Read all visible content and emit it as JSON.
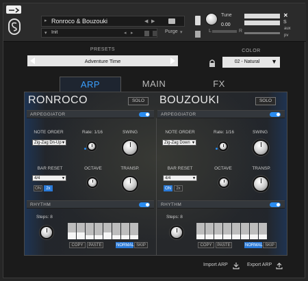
{
  "header": {
    "instrument_name": "Ronroco & Bouzouki",
    "multi_name": "Init",
    "purge_label": "Purge",
    "tune_label": "Tune",
    "tune_value": "0.00",
    "s_label": "S",
    "m_label": "M",
    "aux_label": "aux",
    "pv_label": "pv",
    "left_label": "L",
    "right_label": "R"
  },
  "presets": {
    "label": "PRESETS",
    "value": "Adventure Time"
  },
  "color": {
    "label": "COLOR",
    "value": "02 - Natural"
  },
  "tabs": [
    {
      "label": "ARP"
    },
    {
      "label": "MAIN"
    },
    {
      "label": "FX"
    }
  ],
  "active_tab_color": "#3aa0ff",
  "accent_color": "#2a8cf0",
  "left": {
    "title": "RONROCO",
    "solo": "SOLO",
    "arpeggiator": "ARPEGGIATOR",
    "note_order_label": "NOTE ORDER",
    "note_order": "Zig-Zag Dn-Up",
    "rate_label": "Rate: 1/16",
    "swing_label": "SWING",
    "bar_reset_label": "BAR RESET",
    "bar_reset": "4/4",
    "octave_label": "OCTAVE",
    "transp_label": "TRANSP.",
    "on_label": "ON",
    "x2_label": "2x",
    "rhythm": "RHYTHM",
    "steps_label": "Steps: 8",
    "step_levels": [
      0.4,
      0.4,
      0.25,
      0.25,
      0.4,
      0.25,
      0.25,
      0.25
    ],
    "copy": "COPY",
    "paste": "PASTE",
    "normal": "NORMAL",
    "skip": "SKIP"
  },
  "right": {
    "title": "BOUZOUKI",
    "solo": "SOLO",
    "arpeggiator": "ARPEGGIATOR",
    "note_order_label": "NOTE ORDER",
    "note_order": "Zig-Zag Down",
    "rate_label": "Rate: 1/16",
    "swing_label": "SWING",
    "bar_reset_label": "BAR RESET",
    "bar_reset": "4/4",
    "octave_label": "OCTAVE",
    "transp_label": "TRANSP.",
    "on_label": "ON",
    "x2_label": "2x",
    "rhythm": "RHYTHM",
    "steps_label": "Steps: 8",
    "step_levels": [
      0.3,
      0.3,
      0.3,
      0.3,
      0.3,
      0.3,
      0.3,
      0.3
    ],
    "copy": "COPY",
    "paste": "PASTE",
    "normal": "NORMAL",
    "skip": "SKIP"
  },
  "footer": {
    "import": "Import ARP",
    "export": "Export ARP"
  }
}
